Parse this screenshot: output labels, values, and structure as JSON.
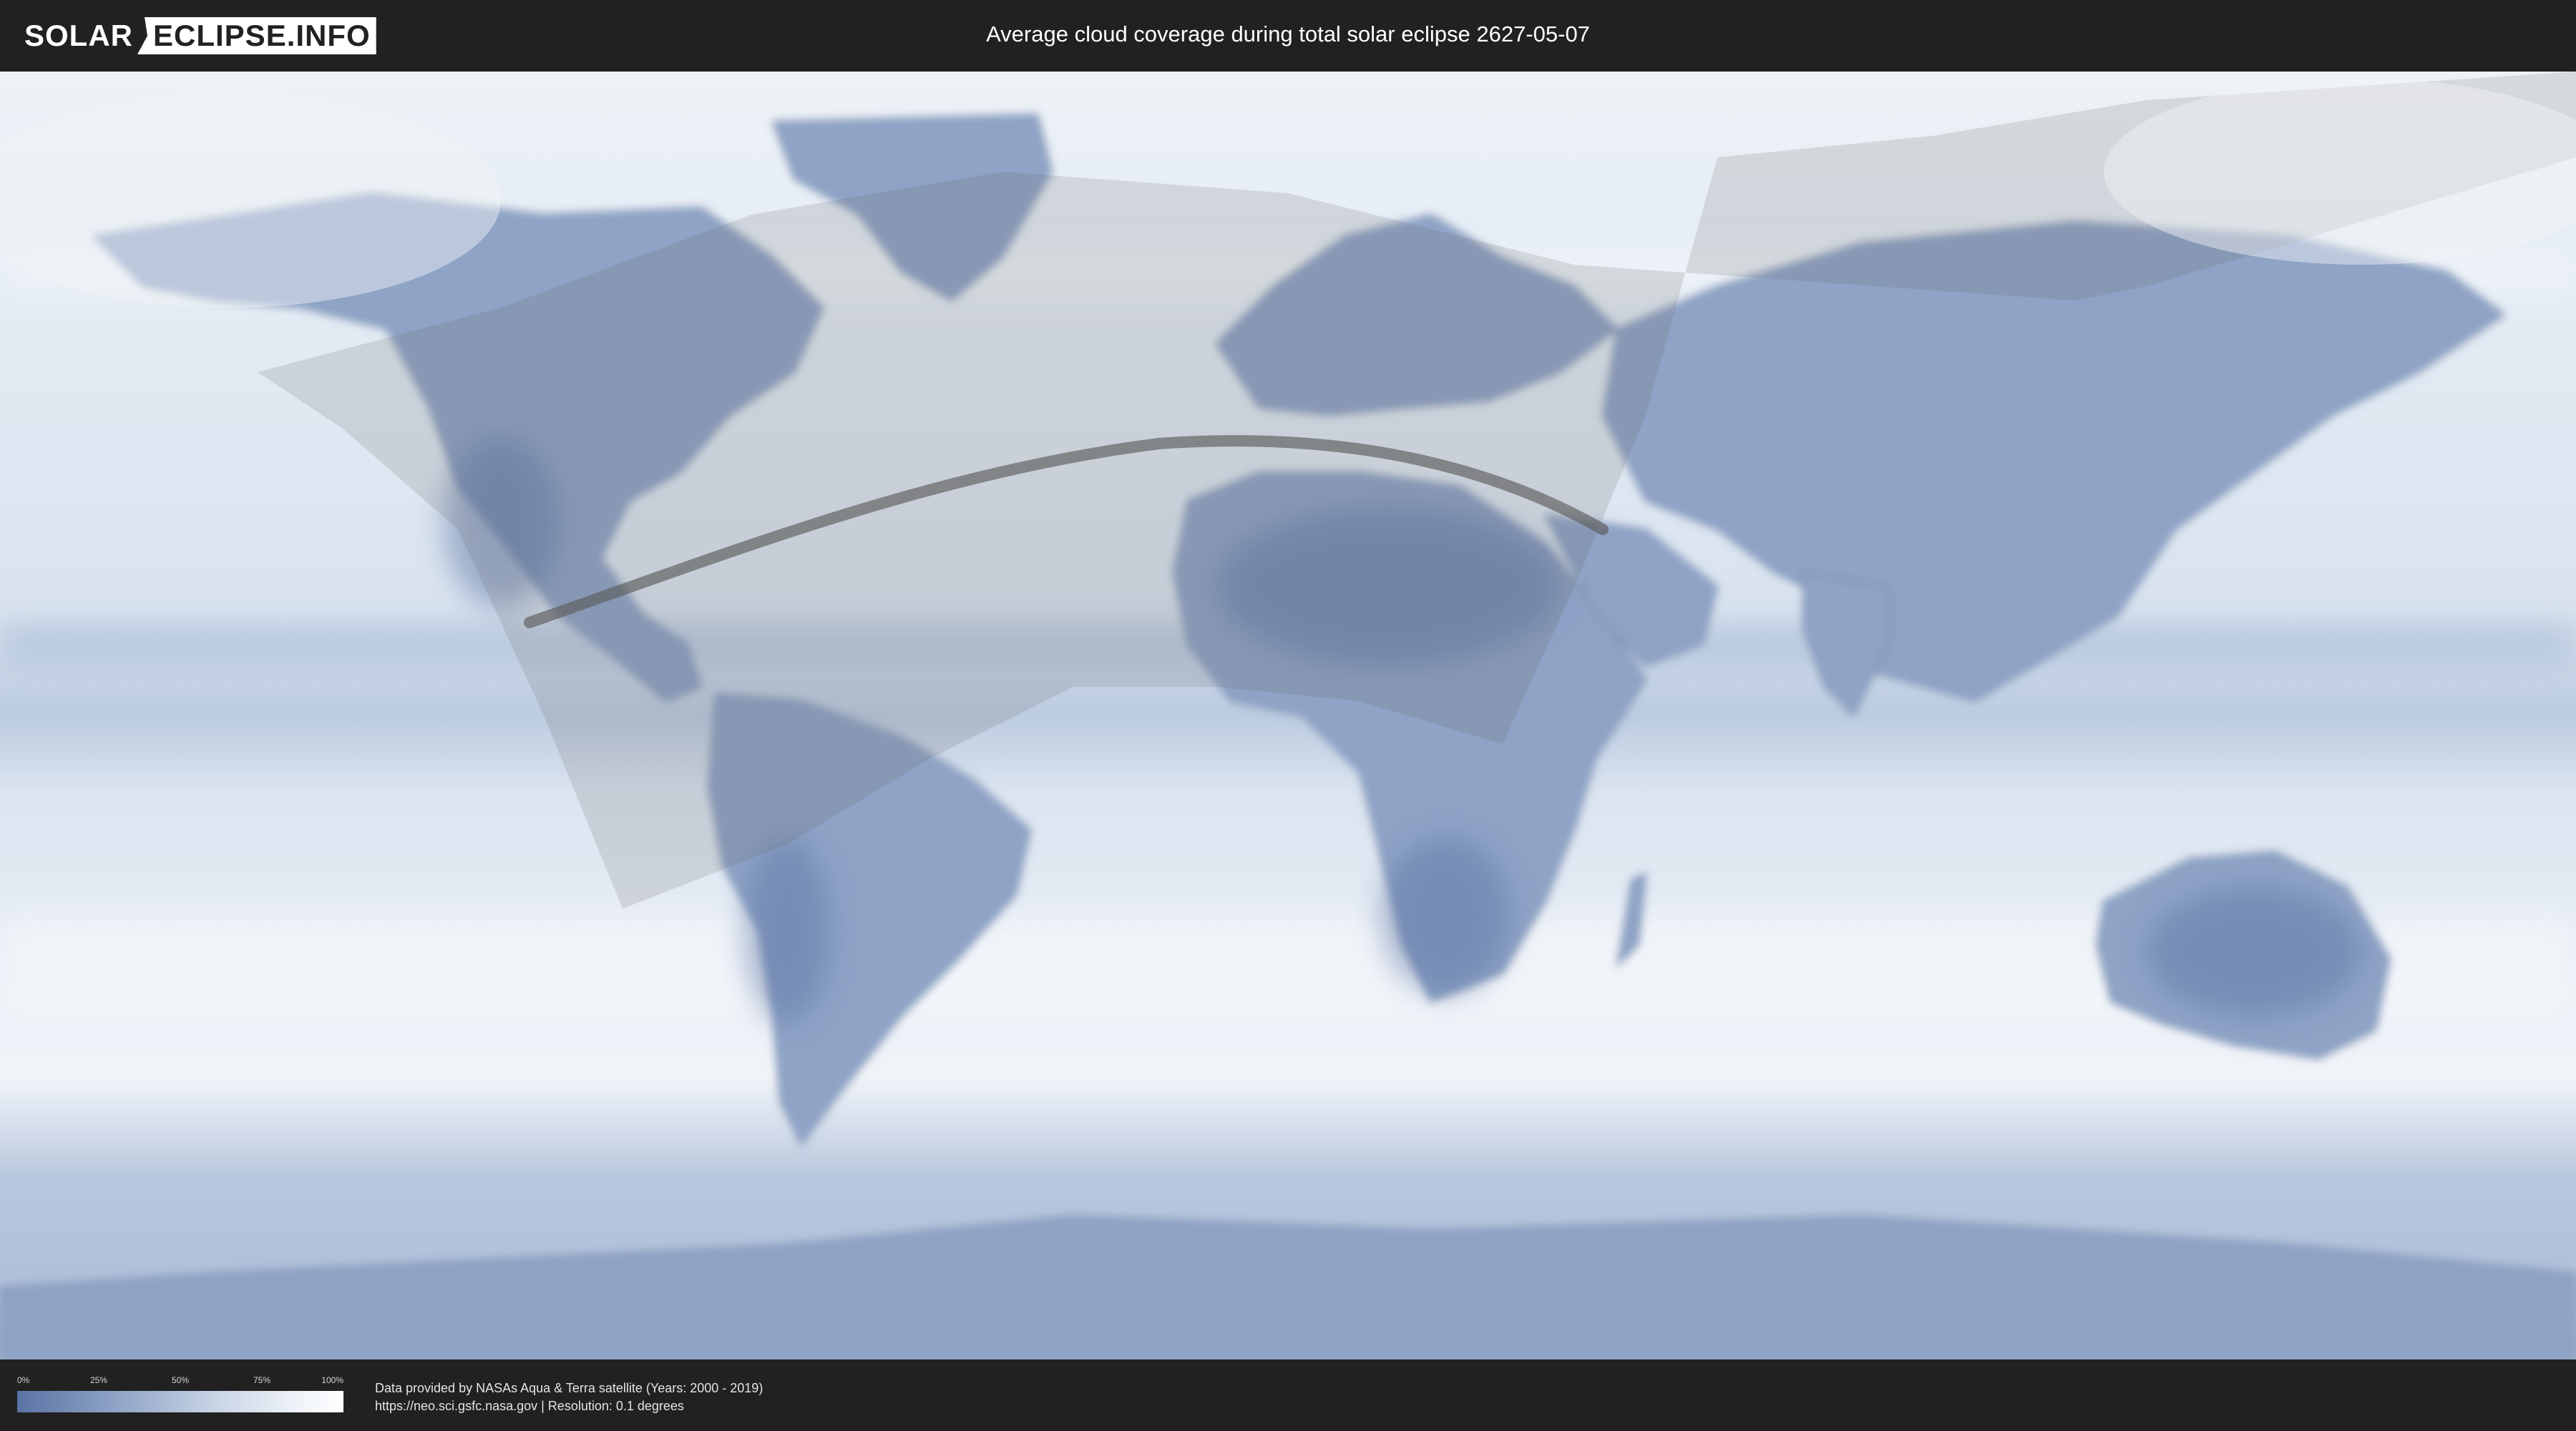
{
  "header": {
    "logo_left": "SOLAR",
    "logo_right": "ECLIPSE.INFO",
    "title": "Average cloud coverage during total solar eclipse 2627-05-07"
  },
  "map": {
    "ocean_color": "#dde6f0",
    "land_color": "#8ba0c4",
    "cloudy_color": "#f4f6fa",
    "shadow_color": "#8a8a8a",
    "path_color": "#5c5c5c"
  },
  "footer": {
    "legend_ticks": [
      "0%",
      "25%",
      "50%",
      "75%",
      "100%"
    ],
    "legend_tick_values": [
      0,
      0.25,
      0.5,
      0.75,
      1
    ],
    "credit_line1": "Data provided by NASAs Aqua & Terra satellite (Years: 2000 - 2019)",
    "credit_line2": "https://neo.sci.gsfc.nasa.gov | Resolution: 0.1 degrees"
  }
}
